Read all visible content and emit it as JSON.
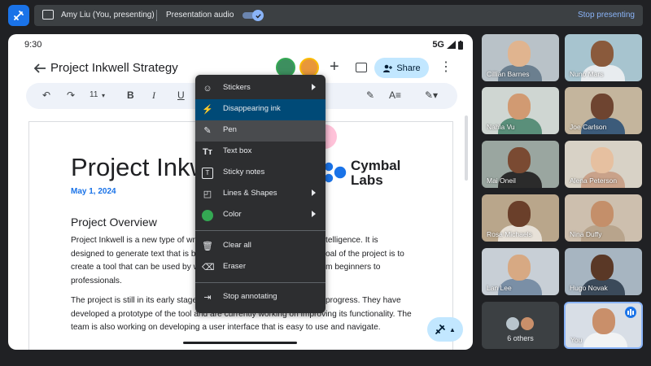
{
  "topbar": {
    "presenter_name": "Amy Liu (You, presenting)",
    "audio_label": "Presentation audio",
    "audio_on": true,
    "stop_label": "Stop presenting"
  },
  "status": {
    "time": "9:30",
    "network": "5G"
  },
  "doc": {
    "title": "Project Inkwell Strategy",
    "share_label": "Share",
    "font_size": "11",
    "heading": "Project Inkwel",
    "date": "May 1, 2024",
    "logo_text_1": "Cymbal",
    "logo_text_2": "Labs",
    "section_heading": "Project Overview",
    "para1_lines": [
      "Project Inkwell is a new type of writ",
      "designed to generate text that is b",
      "create a tool that can be used by w",
      "professionals."
    ],
    "para1_right_lines": [
      "telligence. It is",
      "oal of the project is to",
      "m beginners to",
      ""
    ],
    "para2_lines": [
      "The project is still in its early stage",
      "developed a prototype of the tool and are currently working on improving its functionality. The",
      "team is also working on developing a user interface that is easy to use and navigate."
    ],
    "para2_right_line1": "progress. They have"
  },
  "annotation_menu": {
    "items": [
      {
        "label": "Stickers",
        "icon": "sticker-icon",
        "submenu": true
      },
      {
        "label": "Disappearing ink",
        "icon": "disappearing-ink-icon",
        "submenu": false
      },
      {
        "label": "Pen",
        "icon": "pen-icon",
        "submenu": false
      },
      {
        "label": "Text box",
        "icon": "text-box-icon",
        "submenu": false
      },
      {
        "label": "Sticky notes",
        "icon": "sticky-notes-icon",
        "submenu": false
      },
      {
        "label": "Lines & Shapes",
        "icon": "shapes-icon",
        "submenu": true
      },
      {
        "label": "Color",
        "icon": "color-swatch-icon",
        "submenu": true
      },
      {
        "label": "Clear all",
        "icon": "trash-icon",
        "submenu": false
      },
      {
        "label": "Eraser",
        "icon": "eraser-icon",
        "submenu": false
      },
      {
        "label": "Stop annotating",
        "icon": "exit-icon",
        "submenu": false
      }
    ],
    "color_swatch": "#34a853"
  },
  "participants": [
    {
      "name": "Cillian Barnes"
    },
    {
      "name": "Nuno Mars"
    },
    {
      "name": "Nahla Vu"
    },
    {
      "name": "Joe Carlson"
    },
    {
      "name": "Mai Oneil"
    },
    {
      "name": "Alena Peterson"
    },
    {
      "name": "Rosa Michaels"
    },
    {
      "name": "Nina Duffy"
    },
    {
      "name": "Lan Lee"
    },
    {
      "name": "Hugo Novak"
    }
  ],
  "others_label": "6 others",
  "self_name": "You",
  "colors": {
    "accent": "#1a73e8",
    "ink_highlight": "#004a77",
    "share_bg": "#c2e7ff"
  }
}
